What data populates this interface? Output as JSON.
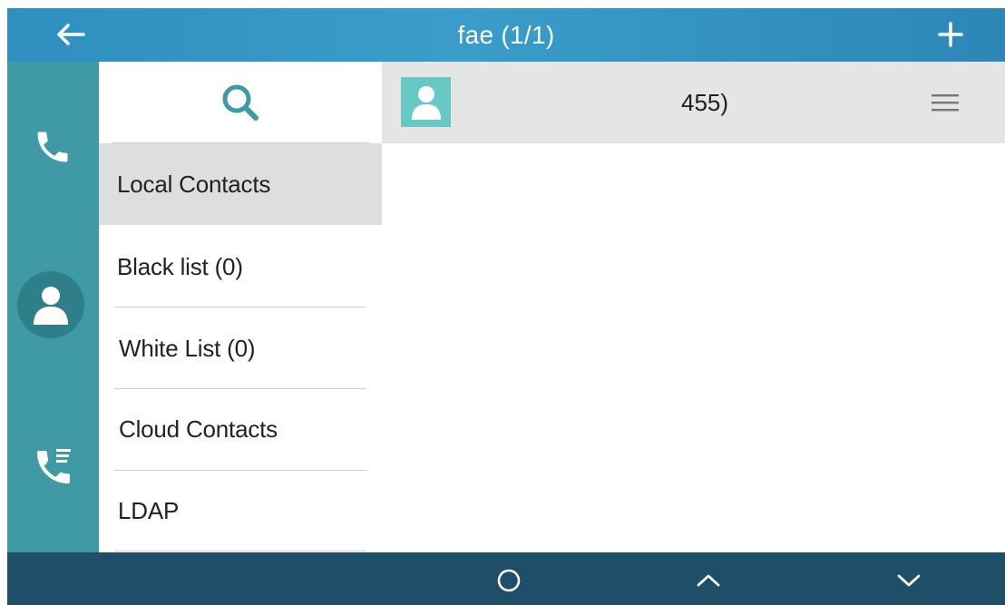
{
  "header": {
    "title": "fae (1/1)",
    "back_icon": "arrow-left-icon",
    "add_icon": "plus-icon"
  },
  "left_rail": {
    "items": [
      {
        "icon": "phone-icon",
        "active": false
      },
      {
        "icon": "contacts-icon",
        "active": true
      },
      {
        "icon": "call-history-icon",
        "active": false
      }
    ]
  },
  "categories": {
    "search_icon": "search-icon",
    "items": [
      {
        "label": "Local Contacts",
        "selected": true
      },
      {
        "label": "Black list (0)",
        "selected": false
      },
      {
        "label": "White List (0)",
        "selected": false
      },
      {
        "label": "Cloud Contacts",
        "selected": false
      },
      {
        "label": "LDAP",
        "selected": false
      }
    ]
  },
  "contacts": {
    "items": [
      {
        "number": "455)",
        "avatar_icon": "person-avatar-icon",
        "menu_icon": "hamburger-menu-icon"
      }
    ]
  },
  "softkeys": {
    "items": [
      {
        "icon": "circle-icon"
      },
      {
        "icon": "chevron-up-icon"
      },
      {
        "icon": "chevron-down-icon"
      }
    ]
  },
  "colors": {
    "header": "#2f8fbf",
    "rail": "#3f9aa5",
    "rail_active": "#2e7f89",
    "selected_item": "#dddedd",
    "avatar": "#67c9c5",
    "search_icon": "#3f9aa5",
    "bottom_bar": "#1e4e68"
  }
}
